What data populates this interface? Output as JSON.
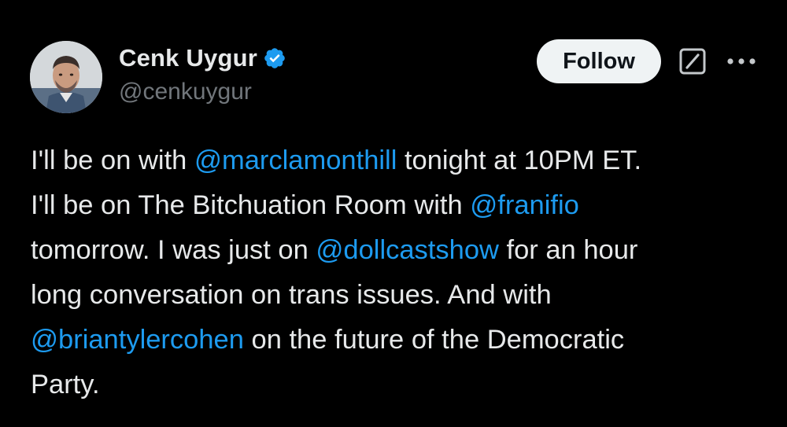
{
  "author": {
    "name": "Cenk Uygur",
    "handle": "@cenkuygur",
    "verified": true,
    "verified_color": "#1d9bf0"
  },
  "actions": {
    "follow_label": "Follow",
    "grok_icon": "grok-icon",
    "more_icon": "more-options-icon"
  },
  "tweet": {
    "lines": [
      {
        "t1": "I'll be on with ",
        "m1": "@marclamonthill",
        "t2": " tonight at 10PM ET."
      },
      {
        "t1": "I'll be on The Bitchuation Room with ",
        "m1": "@franifio"
      },
      {
        "t1": "tomorrow. I was just on ",
        "m1": "@dollcastshow",
        "t2": " for an hour"
      },
      {
        "t1": "long conversation on trans issues. And with"
      },
      {
        "m1": "@briantylercohen",
        "t2": " on the future of the Democratic"
      },
      {
        "t1": "Party."
      }
    ]
  },
  "colors": {
    "background": "#000000",
    "text": "#e7e9ea",
    "secondary_text": "#71767b",
    "link": "#1d9bf0",
    "follow_bg": "#eff3f4"
  }
}
